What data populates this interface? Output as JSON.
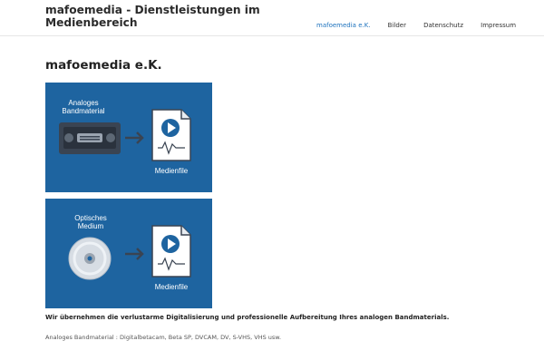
{
  "header": {
    "site_title": "mafoemedia - Dienstleistungen im Medienbereich",
    "nav": [
      {
        "label": "mafoemedia e.K.",
        "active": true
      },
      {
        "label": "Bilder"
      },
      {
        "label": "Datenschutz"
      },
      {
        "label": "Impressum"
      }
    ]
  },
  "main": {
    "title": "mafoemedia e.K.",
    "panel_1": {
      "source_label_line1": "Analoges",
      "source_label_line2": "Bandmaterial",
      "target_label": "Medienfile",
      "source_icon": "vhs-cassette-icon",
      "target_icon": "media-file-play-icon"
    },
    "panel_2": {
      "source_label_line1": "Optisches",
      "source_label_line2": "Medium",
      "target_label": "Medienfile",
      "source_icon": "optical-disc-icon",
      "target_icon": "media-file-play-icon"
    },
    "intro_text": "Wir übernehmen die verlustarme Digitalisierung und professionelle Aufbereitung Ihres analogen Bandmaterials.",
    "list_line": "Analoges Bandmaterial : Digitalbetacam, Beta SP, DVCAM, DV, S-VHS, VHS usw."
  },
  "colors": {
    "panel_blue": "#1e64a0",
    "accent_link": "#1e73be",
    "icon_dark": "#3a4452"
  }
}
